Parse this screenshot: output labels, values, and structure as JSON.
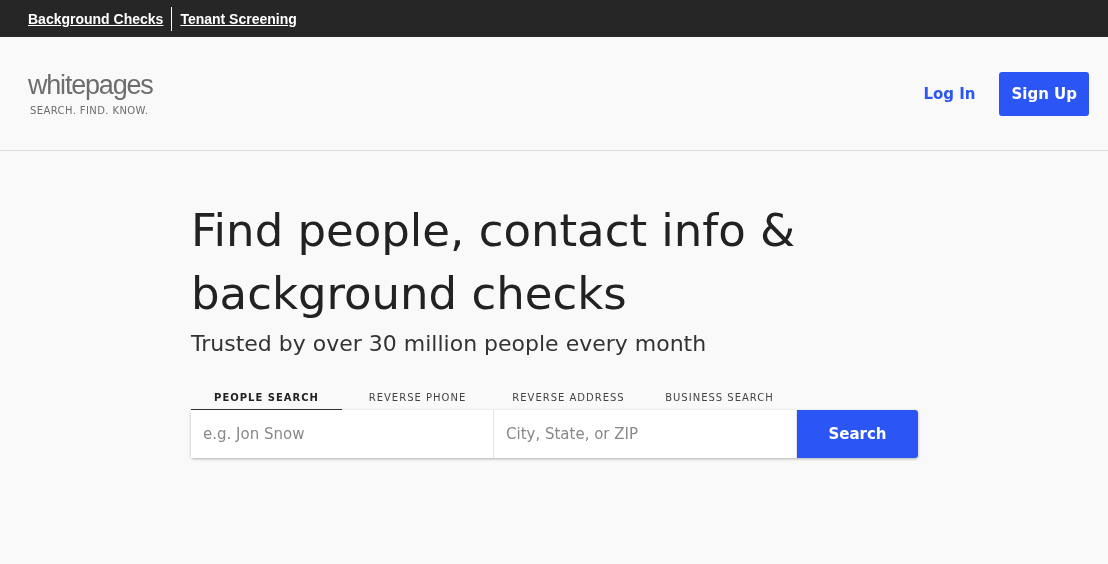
{
  "top_links": [
    "Background Checks",
    "Tenant Screening"
  ],
  "logo": {
    "name": "whitepages",
    "tagline": "SEARCH. FIND. KNOW."
  },
  "header_actions": {
    "login": "Log In",
    "signup": "Sign Up"
  },
  "hero": {
    "title": "Find people, contact info & background checks",
    "subtitle": "Trusted by over 30 million people every month"
  },
  "tabs": [
    {
      "label": "PEOPLE SEARCH",
      "selected": true
    },
    {
      "label": "REVERSE PHONE",
      "selected": false
    },
    {
      "label": "REVERSE ADDRESS",
      "selected": false
    },
    {
      "label": "BUSINESS SEARCH",
      "selected": false
    }
  ],
  "search": {
    "name_placeholder": "e.g. Jon Snow",
    "location_placeholder": "City, State, or ZIP",
    "button": "Search"
  }
}
